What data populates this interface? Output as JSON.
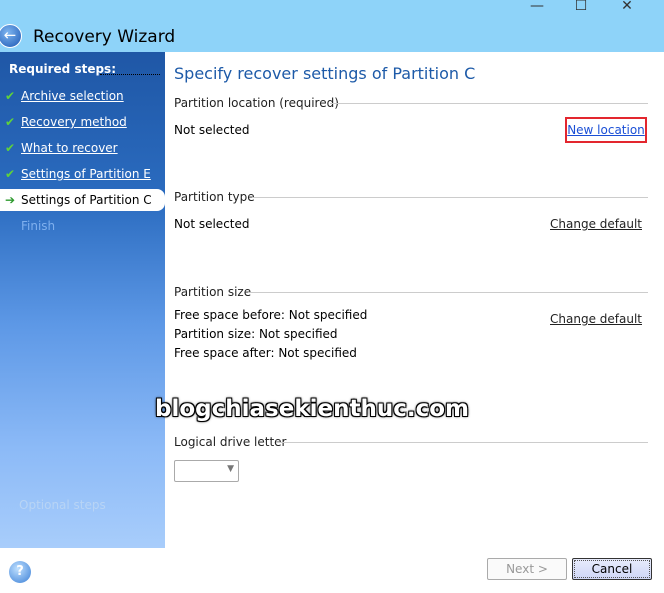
{
  "window": {
    "title": "Recovery Wizard",
    "minimize": "—",
    "maximize": "☐",
    "close": "✕"
  },
  "sidebar": {
    "required_label": "Required steps:",
    "steps": [
      {
        "label": "Archive selection",
        "state": "done"
      },
      {
        "label": "Recovery method",
        "state": "done"
      },
      {
        "label": "What to recover",
        "state": "done"
      },
      {
        "label": "Settings of Partition E",
        "state": "done"
      },
      {
        "label": "Settings of Partition C",
        "state": "current"
      },
      {
        "label": "Finish",
        "state": "pending"
      }
    ],
    "optional_label": "Optional steps"
  },
  "main": {
    "heading": "Specify recover settings of Partition C",
    "location": {
      "label": "Partition location (required)",
      "value": "Not selected",
      "link": "New location"
    },
    "type": {
      "label": "Partition type",
      "value": "Not selected",
      "link": "Change default"
    },
    "size": {
      "label": "Partition size",
      "free_before": "Free space before: Not specified",
      "size": "Partition size: Not specified",
      "free_after": "Free space after: Not specified",
      "link": "Change default"
    },
    "drive_letter": {
      "label": "Logical drive letter",
      "value": ""
    }
  },
  "watermark": "blogchiasekienthuc.com",
  "footer": {
    "next": "Next >",
    "cancel": "Cancel"
  },
  "colors": {
    "accent": "#1d5aa8",
    "highlight_border": "#e3262e",
    "titlebar": "#8ed3f9"
  }
}
